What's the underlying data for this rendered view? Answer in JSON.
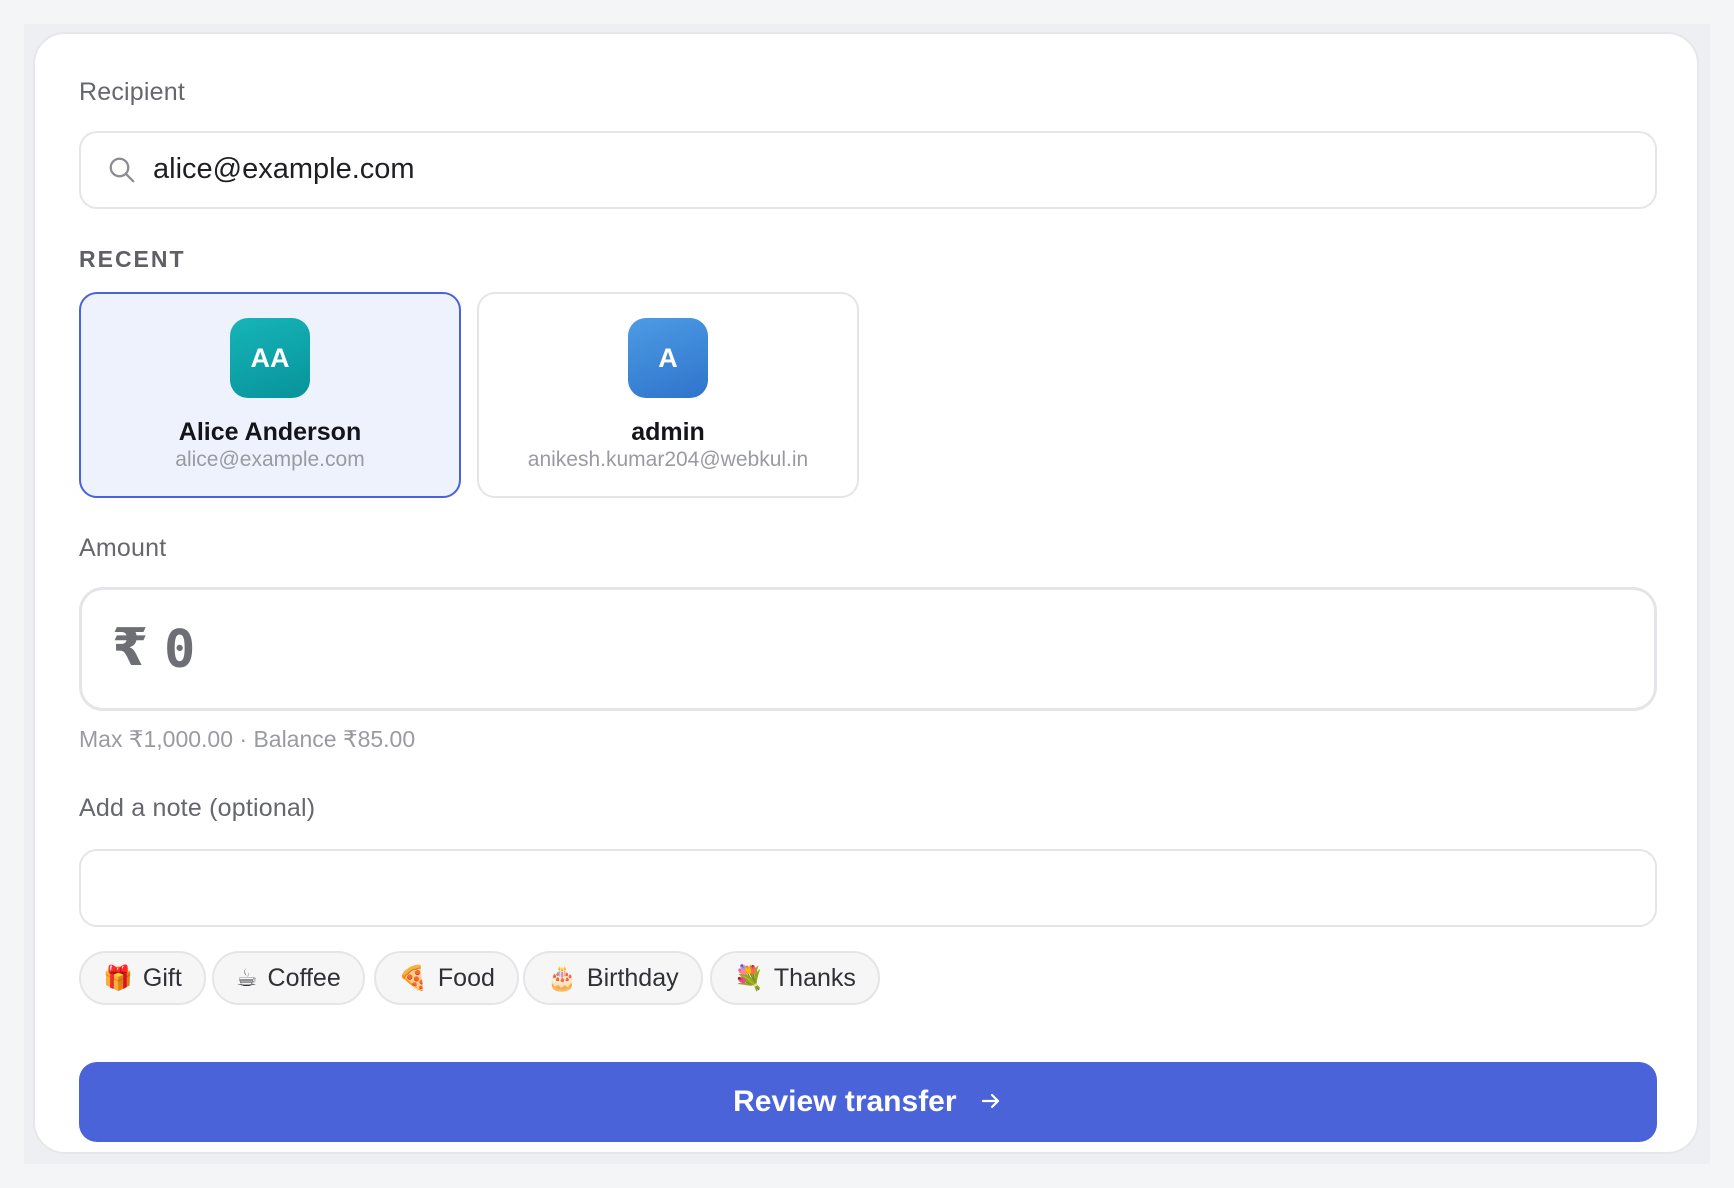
{
  "recipient": {
    "label": "Recipient",
    "search_value": "alice@example.com",
    "search_icon": "search-icon"
  },
  "recent": {
    "caption": "RECENT",
    "contacts": [
      {
        "initials": "AA",
        "name": "Alice Anderson",
        "email": "alice@example.com",
        "avatar_color": "#0ea5a8",
        "selected": true
      },
      {
        "initials": "A",
        "name": "admin",
        "email": "anikesh.kumar204@webkul.in",
        "avatar_color": "#3b86d8",
        "selected": false
      }
    ]
  },
  "amount": {
    "label": "Amount",
    "currency_symbol": "₹",
    "value": "0",
    "helper": "Max ₹1,000.00 · Balance ₹85.00"
  },
  "note": {
    "label": "Add a note (optional)",
    "value": ""
  },
  "quick_notes": [
    {
      "emoji": "🎁",
      "label": "Gift"
    },
    {
      "emoji": "☕",
      "label": "Coffee"
    },
    {
      "emoji": "🍕",
      "label": "Food"
    },
    {
      "emoji": "🎂",
      "label": "Birthday"
    },
    {
      "emoji": "💐",
      "label": "Thanks"
    }
  ],
  "primary_action": {
    "label": "Review transfer",
    "icon": "arrow-right-icon",
    "color": "#4a63d8"
  },
  "colors": {
    "accent": "#4a63d8",
    "selected_card_bg": "#edf2fd"
  }
}
